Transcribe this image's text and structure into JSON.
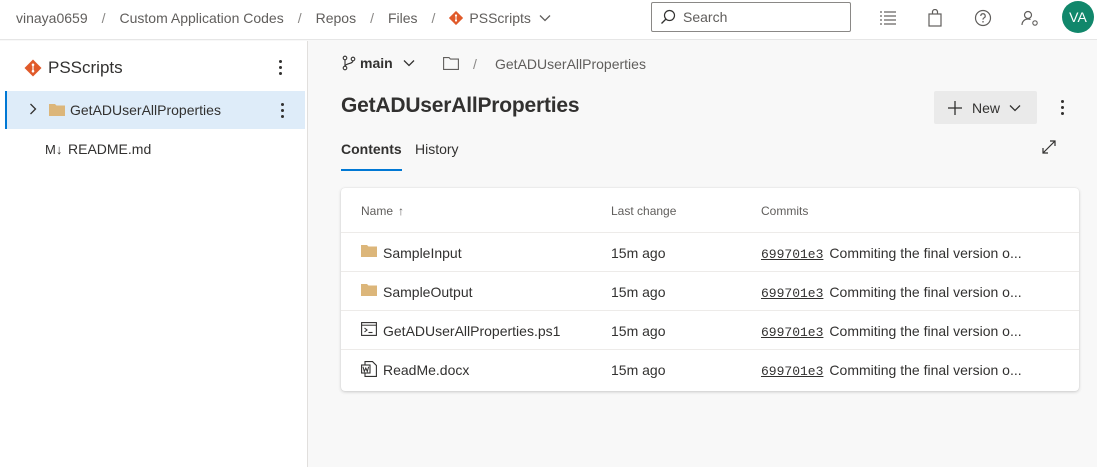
{
  "breadcrumbs": {
    "items": [
      "vinaya0659",
      "Custom Application Codes",
      "Repos",
      "Files"
    ],
    "repo": "PSScripts",
    "separator": "/"
  },
  "search": {
    "placeholder": "Search",
    "value": ""
  },
  "top_icons": [
    "list-icon",
    "shopping-bag-icon",
    "help-icon",
    "user-settings-icon"
  ],
  "user": {
    "initials": "VA",
    "avatar_color": "#11876b"
  },
  "sidebar": {
    "repo_name": "PSScripts",
    "items": [
      {
        "label": "GetADUserAllProperties",
        "type": "folder",
        "selected": true
      },
      {
        "label": "README.md",
        "type": "markdown",
        "icon_text": "M↓",
        "selected": false
      }
    ]
  },
  "main": {
    "branch": "main",
    "path_current": "GetADUserAllProperties",
    "title": "GetADUserAllProperties",
    "new_button_label": "New",
    "tabs": [
      {
        "label": "Contents",
        "active": true
      },
      {
        "label": "History",
        "active": false
      }
    ],
    "table": {
      "headers": {
        "name": "Name",
        "last_change": "Last change",
        "commits": "Commits"
      },
      "sort_indicator": "↑",
      "rows": [
        {
          "name": "SampleInput",
          "type": "folder",
          "last_change": "15m ago",
          "commit_id": "699701e3",
          "commit_msg": "Commiting the final version o..."
        },
        {
          "name": "SampleOutput",
          "type": "folder",
          "last_change": "15m ago",
          "commit_id": "699701e3",
          "commit_msg": "Commiting the final version o..."
        },
        {
          "name": "GetADUserAllProperties.ps1",
          "type": "powershell",
          "last_change": "15m ago",
          "commit_id": "699701e3",
          "commit_msg": "Commiting the final version o..."
        },
        {
          "name": "ReadMe.docx",
          "type": "word",
          "last_change": "15m ago",
          "commit_id": "699701e3",
          "commit_msg": "Commiting the final version o..."
        }
      ]
    }
  },
  "colors": {
    "accent": "#0078d4",
    "repo_icon": "#e05a2a",
    "folder": "#dcb67a",
    "selected_bg": "#deecf9"
  }
}
